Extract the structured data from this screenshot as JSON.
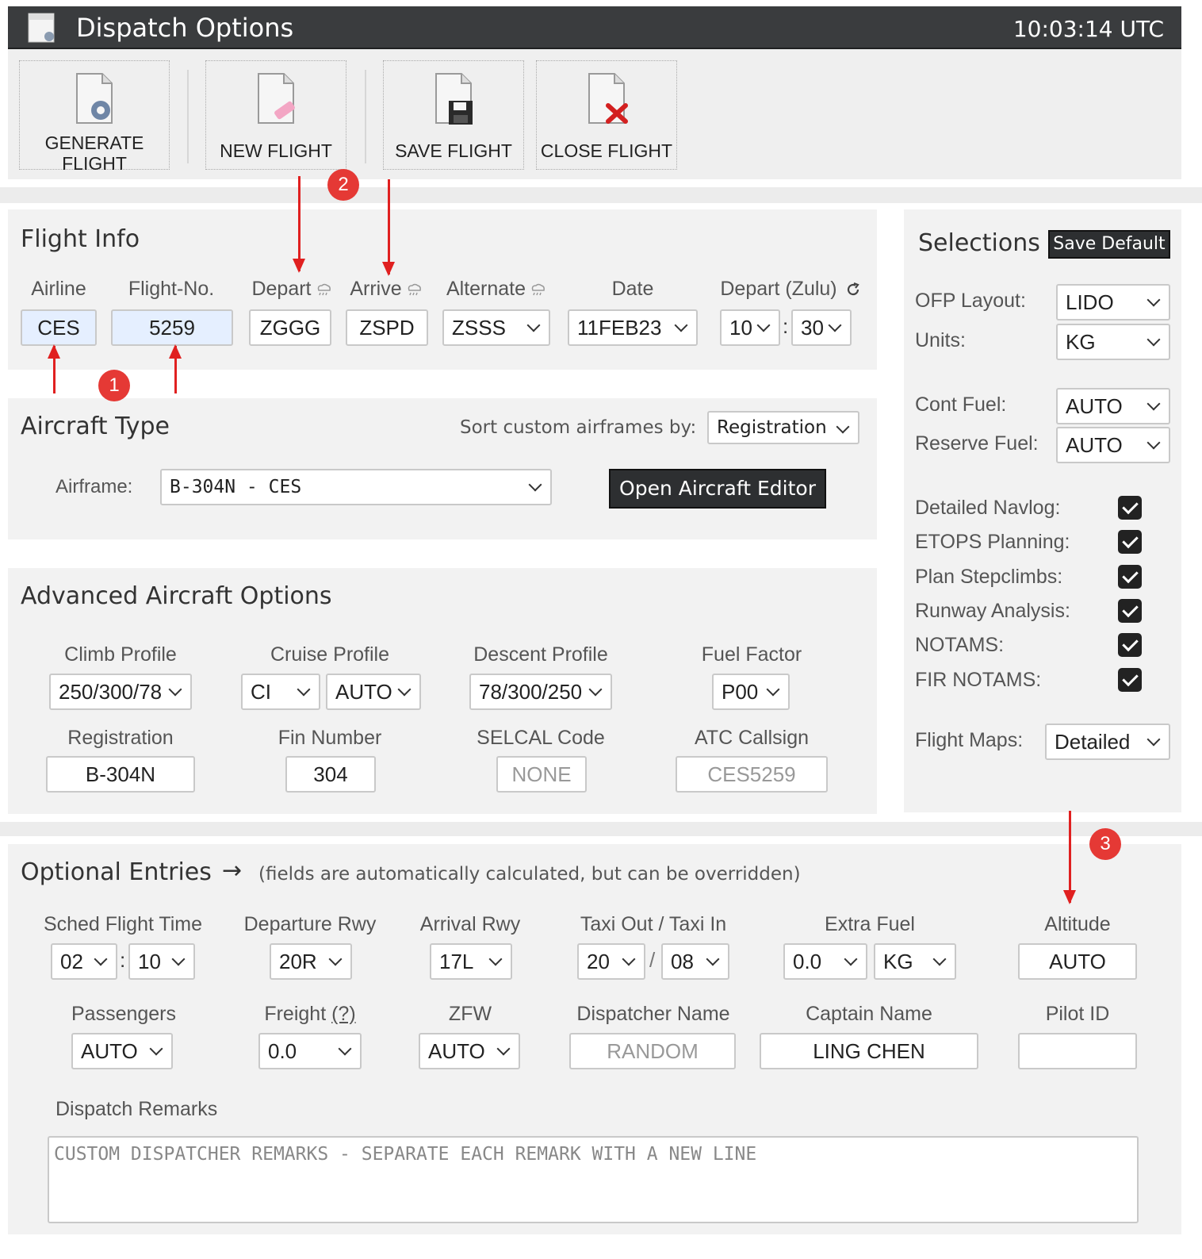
{
  "window": {
    "title": "Dispatch Options",
    "clock": "10:03:14 UTC"
  },
  "toolbar": {
    "generate_line1": "GENERATE",
    "generate_line2": "FLIGHT",
    "new_flight": "NEW FLIGHT",
    "save_flight": "SAVE FLIGHT",
    "close_flight": "CLOSE FLIGHT"
  },
  "flight_info": {
    "title": "Flight Info",
    "airline_label": "Airline",
    "airline": "CES",
    "flight_no_label": "Flight-No.",
    "flight_no": "5259",
    "depart_label": "Depart",
    "depart": "ZGGG",
    "arrive_label": "Arrive",
    "arrive": "ZSPD",
    "alternate_label": "Alternate",
    "alternate": "ZSSS",
    "date_label": "Date",
    "date": "11FEB23",
    "depart_zulu_label": "Depart (Zulu)",
    "depart_hour": "10",
    "depart_minute": "30"
  },
  "aircraft_type": {
    "title": "Aircraft Type",
    "sort_label": "Sort custom airframes by:",
    "sort_value": "Registration",
    "airframe_label": "Airframe:",
    "airframe_value": "B-304N - CES",
    "open_editor": "Open Aircraft Editor"
  },
  "advanced": {
    "title": "Advanced Aircraft Options",
    "climb_label": "Climb Profile",
    "climb": "250/300/78",
    "cruise_label": "Cruise Profile",
    "cruise_mode": "CI",
    "cruise_value": "AUTO",
    "descent_label": "Descent Profile",
    "descent": "78/300/250",
    "fuel_factor_label": "Fuel Factor",
    "fuel_factor": "P00",
    "registration_label": "Registration",
    "registration": "B-304N",
    "fin_label": "Fin Number",
    "fin": "304",
    "selcal_label": "SELCAL Code",
    "selcal_placeholder": "NONE",
    "atc_label": "ATC Callsign",
    "atc_placeholder": "CES5259"
  },
  "selections": {
    "title": "Selections",
    "save_default": "Save Default",
    "ofp_label": "OFP Layout:",
    "ofp": "LIDO",
    "units_label": "Units:",
    "units": "KG",
    "cont_fuel_label": "Cont Fuel:",
    "cont_fuel": "AUTO",
    "reserve_fuel_label": "Reserve Fuel:",
    "reserve_fuel": "AUTO",
    "checks": [
      {
        "label": "Detailed Navlog:",
        "checked": true
      },
      {
        "label": "ETOPS Planning:",
        "checked": true
      },
      {
        "label": "Plan Stepclimbs:",
        "checked": true
      },
      {
        "label": "Runway Analysis:",
        "checked": true
      },
      {
        "label": "NOTAMS:",
        "checked": true
      },
      {
        "label": "FIR NOTAMS:",
        "checked": true
      }
    ],
    "maps_label": "Flight Maps:",
    "maps": "Detailed"
  },
  "optional": {
    "title": "Optional Entries",
    "arrow": "→",
    "note": "(fields are automatically calculated, but can be overridden)",
    "sched_label": "Sched Flight Time",
    "sched_hour": "02",
    "sched_minute": "10",
    "dep_rwy_label": "Departure Rwy",
    "dep_rwy": "20R",
    "arr_rwy_label": "Arrival Rwy",
    "arr_rwy": "17L",
    "taxi_label": "Taxi Out / Taxi In",
    "taxi_out": "20",
    "taxi_in": "08",
    "extra_fuel_label": "Extra Fuel",
    "extra_fuel": "0.0",
    "extra_fuel_unit": "KG",
    "altitude_label": "Altitude",
    "altitude": "AUTO",
    "pax_label": "Passengers",
    "pax": "AUTO",
    "freight_label": "Freight",
    "freight_help": "(?)",
    "freight": "0.0",
    "zfw_label": "ZFW",
    "zfw": "AUTO",
    "dispatcher_label": "Dispatcher Name",
    "dispatcher_placeholder": "RANDOM",
    "captain_label": "Captain Name",
    "captain": "LING CHEN",
    "pilot_id_label": "Pilot ID",
    "pilot_id": "",
    "remarks_label": "Dispatch Remarks",
    "remarks_placeholder": "CUSTOM DISPATCHER REMARKS - SEPARATE EACH REMARK WITH A NEW LINE"
  },
  "annotations": {
    "badge1": "1",
    "badge2": "2",
    "badge3": "3"
  },
  "colors": {
    "titlebar": "#3a3c3e",
    "panel": "#f2f2f2",
    "annotation_red": "#e53935",
    "dark_button": "#2d2f31"
  }
}
